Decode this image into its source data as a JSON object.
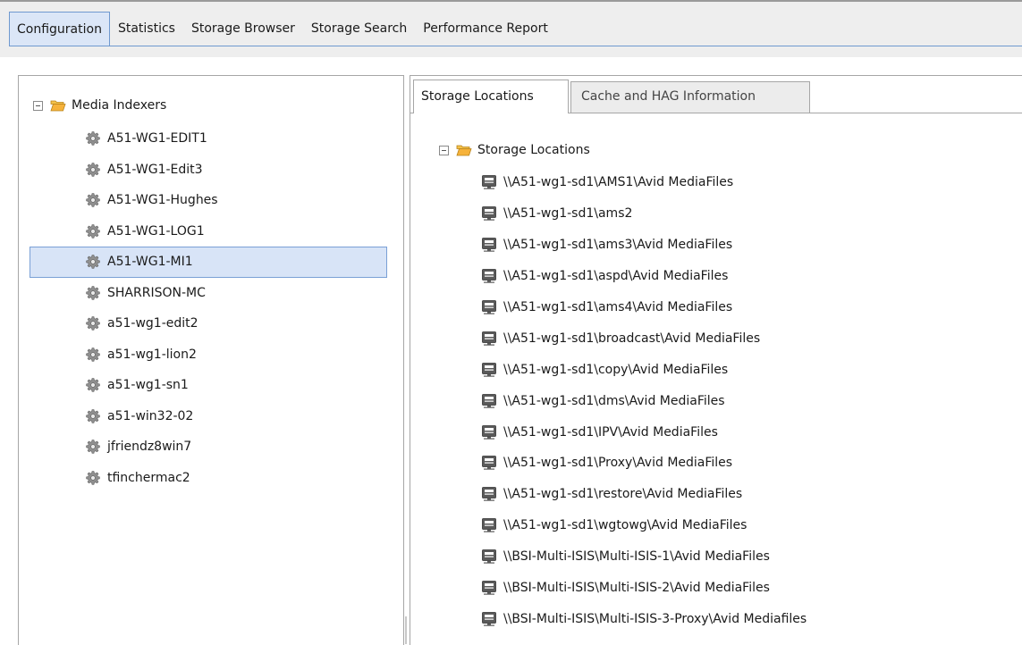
{
  "menu": {
    "items": [
      "Configuration",
      "Statistics",
      "Storage Browser",
      "Storage Search",
      "Performance Report"
    ],
    "active_index": 0
  },
  "left_tree": {
    "root_label": "Media Indexers",
    "items": [
      "A51-WG1-EDIT1",
      "A51-WG1-Edit3",
      "A51-WG1-Hughes",
      "A51-WG1-LOG1",
      "A51-WG1-MI1",
      "SHARRISON-MC",
      "a51-wg1-edit2",
      "a51-wg1-lion2",
      "a51-wg1-sn1",
      "a51-win32-02",
      "jfriendz8win7",
      "tfinchermac2"
    ],
    "selected_index": 4
  },
  "tabs": {
    "storage_locations": "Storage Locations",
    "cache_hag": "Cache and HAG Information"
  },
  "storage_tree": {
    "root_label": "Storage Locations",
    "items": [
      "\\\\A51-wg1-sd1\\AMS1\\Avid MediaFiles",
      "\\\\A51-wg1-sd1\\ams2",
      "\\\\A51-wg1-sd1\\ams3\\Avid MediaFiles",
      "\\\\A51-wg1-sd1\\aspd\\Avid MediaFiles",
      "\\\\A51-wg1-sd1\\ams4\\Avid MediaFiles",
      "\\\\A51-wg1-sd1\\broadcast\\Avid MediaFiles",
      "\\\\A51-wg1-sd1\\copy\\Avid MediaFiles",
      "\\\\A51-wg1-sd1\\dms\\Avid MediaFiles",
      "\\\\A51-wg1-sd1\\IPV\\Avid MediaFiles",
      "\\\\A51-wg1-sd1\\Proxy\\Avid MediaFiles",
      "\\\\A51-wg1-sd1\\restore\\Avid MediaFiles",
      "\\\\A51-wg1-sd1\\wgtowg\\Avid MediaFiles",
      "\\\\BSI-Multi-ISIS\\Multi-ISIS-1\\Avid MediaFiles",
      "\\\\BSI-Multi-ISIS\\Multi-ISIS-2\\Avid MediaFiles",
      "\\\\BSI-Multi-ISIS\\Multi-ISIS-3-Proxy\\Avid Mediafiles"
    ]
  },
  "icons": {
    "tree_expander": "collapse-minus-icon",
    "folder": "open-folder-icon",
    "media_indexer": "gear-icon",
    "storage_location": "server-icon"
  },
  "colors": {
    "selection": "#d8e4f7",
    "selection_border": "#7aa0d6",
    "folder": "#f0a020",
    "menu_active": "#dbe6f7"
  }
}
